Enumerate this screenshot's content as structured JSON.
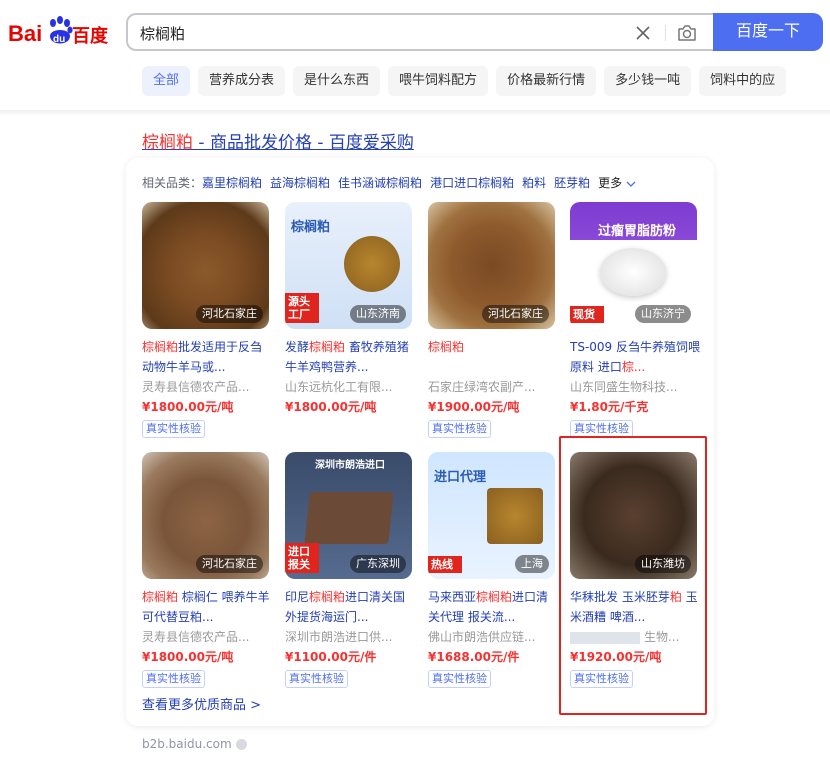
{
  "logo": {
    "text": "百度",
    "latin": "Bai",
    "paw": "du"
  },
  "search": {
    "query": "棕榈粕",
    "button": "百度一下"
  },
  "tabs": [
    "全部",
    "营养成分表",
    "是什么东西",
    "喂牛饲料配方",
    "价格最新行情",
    "多少钱一吨",
    "饲料中的应"
  ],
  "result": {
    "title_hl": "棕榈粕",
    "title_rest": " - 商品批发价格 - 百度爱采购",
    "related_label": "相关品类：",
    "related": [
      "嘉里棕榈粕",
      "益海棕榈粕",
      "佳书涵诚棕榈粕",
      "港口进口棕榈粕",
      "粕料",
      "胚芽粕"
    ],
    "related_more": "更多",
    "see_more": "查看更多优质商品 >",
    "source": "b2b.baidu.com"
  },
  "products": [
    {
      "location": "河北石家庄",
      "title_parts": [
        [
          "hl",
          "棕榈粕"
        ],
        [
          "n",
          "批发适用于反刍动物牛羊马或..."
        ]
      ],
      "shop": "灵寿县信德农产品...",
      "price": "¥1800.00元/吨",
      "verify": "真实性核验",
      "image_text": ""
    },
    {
      "location": "山东济南",
      "title_parts": [
        [
          "n",
          "发酵"
        ],
        [
          "hl",
          "棕榈粕"
        ],
        [
          "n",
          " 畜牧养殖猪牛羊鸡鸭营养..."
        ]
      ],
      "shop": "山东远杭化工有限...",
      "price": "¥1800.00元/吨",
      "verify": "",
      "image_text": "棕榈粕",
      "image_badge": "源头工厂"
    },
    {
      "location": "河北石家庄",
      "title_parts": [
        [
          "hl",
          "棕榈粕"
        ]
      ],
      "shop": "石家庄绿湾农副产...",
      "price": "¥1900.00元/吨",
      "verify": "真实性核验",
      "image_text": ""
    },
    {
      "location": "山东济宁",
      "title_parts": [
        [
          "n",
          "TS-009 反刍牛养殖饲喂原料 进口"
        ],
        [
          "hl",
          "棕..."
        ]
      ],
      "shop": "山东同盛生物科技...",
      "price": "¥1.80元/千克",
      "verify": "真实性核验",
      "image_text": "过瘤胃脂肪粉",
      "image_badge": "现货"
    },
    {
      "location": "河北石家庄",
      "title_parts": [
        [
          "hl",
          "棕榈粕"
        ],
        [
          "n",
          " 棕榈仁 喂养牛羊 可代替豆粕..."
        ]
      ],
      "shop": "灵寿县信德农产品...",
      "price": "¥1800.00元/吨",
      "verify": "真实性核验",
      "image_text": ""
    },
    {
      "location": "广东深圳",
      "title_parts": [
        [
          "n",
          "印尼"
        ],
        [
          "hl",
          "棕榈粕"
        ],
        [
          "n",
          "进口清关国外提货海运门..."
        ]
      ],
      "shop": "深圳市朗浩进口供...",
      "price": "¥1100.00元/件",
      "verify": "真实性核验",
      "image_text": "深圳市朗浩进口",
      "image_badge": "进口报关"
    },
    {
      "location": "上海",
      "title_parts": [
        [
          "n",
          "马来西亚"
        ],
        [
          "hl",
          "棕榈粕"
        ],
        [
          "n",
          "进口清关代理 报关流..."
        ]
      ],
      "shop": "佛山市朗浩供应链...",
      "price": "¥1688.00元/件",
      "verify": "真实性核验",
      "image_text": "进口代理",
      "image_badge": "热线"
    },
    {
      "location": "山东潍坊",
      "title_parts": [
        [
          "n",
          "华秣批发 玉米胚芽"
        ],
        [
          "hl",
          "粕"
        ],
        [
          "n",
          " 玉米酒糟 啤酒..."
        ]
      ],
      "shop": "生物...",
      "price": "¥1920.00元/吨",
      "verify": "真实性核验",
      "image_text": ""
    }
  ],
  "colors": {
    "brand_blue": "#4e6ef2",
    "link": "#2440b3",
    "highlight": "#f73131",
    "box": "#e0241e"
  }
}
